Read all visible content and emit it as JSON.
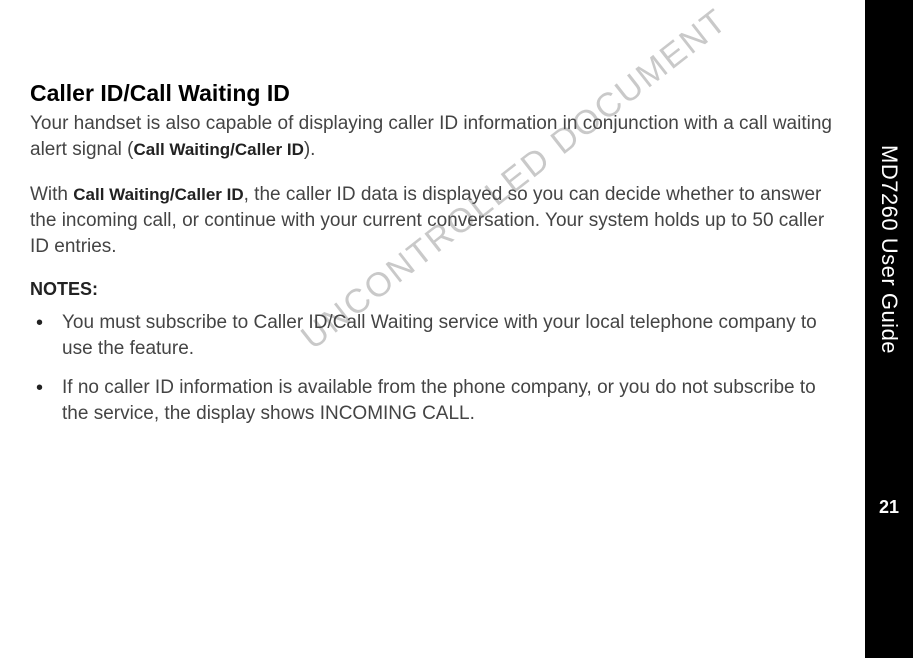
{
  "sidebar": {
    "title": "MD7260 User Guide",
    "page_number": "21"
  },
  "heading": "Caller ID/Call Waiting ID",
  "para1_a": "Your handset is also capable of displaying caller ID information in conjunction with a call waiting alert signal (",
  "para1_bold": "Call Waiting/Caller ID",
  "para1_b": ").",
  "para2_a": "With ",
  "para2_bold": "Call Waiting/Caller ID",
  "para2_b": ", the caller ID data is displayed so you can decide whether to answer the incoming call, or continue with your current conversation. Your system holds up to 50 caller ID entries.",
  "notes_label": "NOTES:",
  "notes": [
    {
      "a": "You must subscribe to ",
      "bold": "Caller ID/Call Waiting",
      "b": " service with your local telephone company to use the feature."
    },
    {
      "a": "If no caller ID information is available from the phone company, or you do not subscribe to the service, the display shows ",
      "bold": "INCOMING CALL",
      "b": "."
    }
  ],
  "watermark": "UNCONTROLLED DOCUMENT"
}
